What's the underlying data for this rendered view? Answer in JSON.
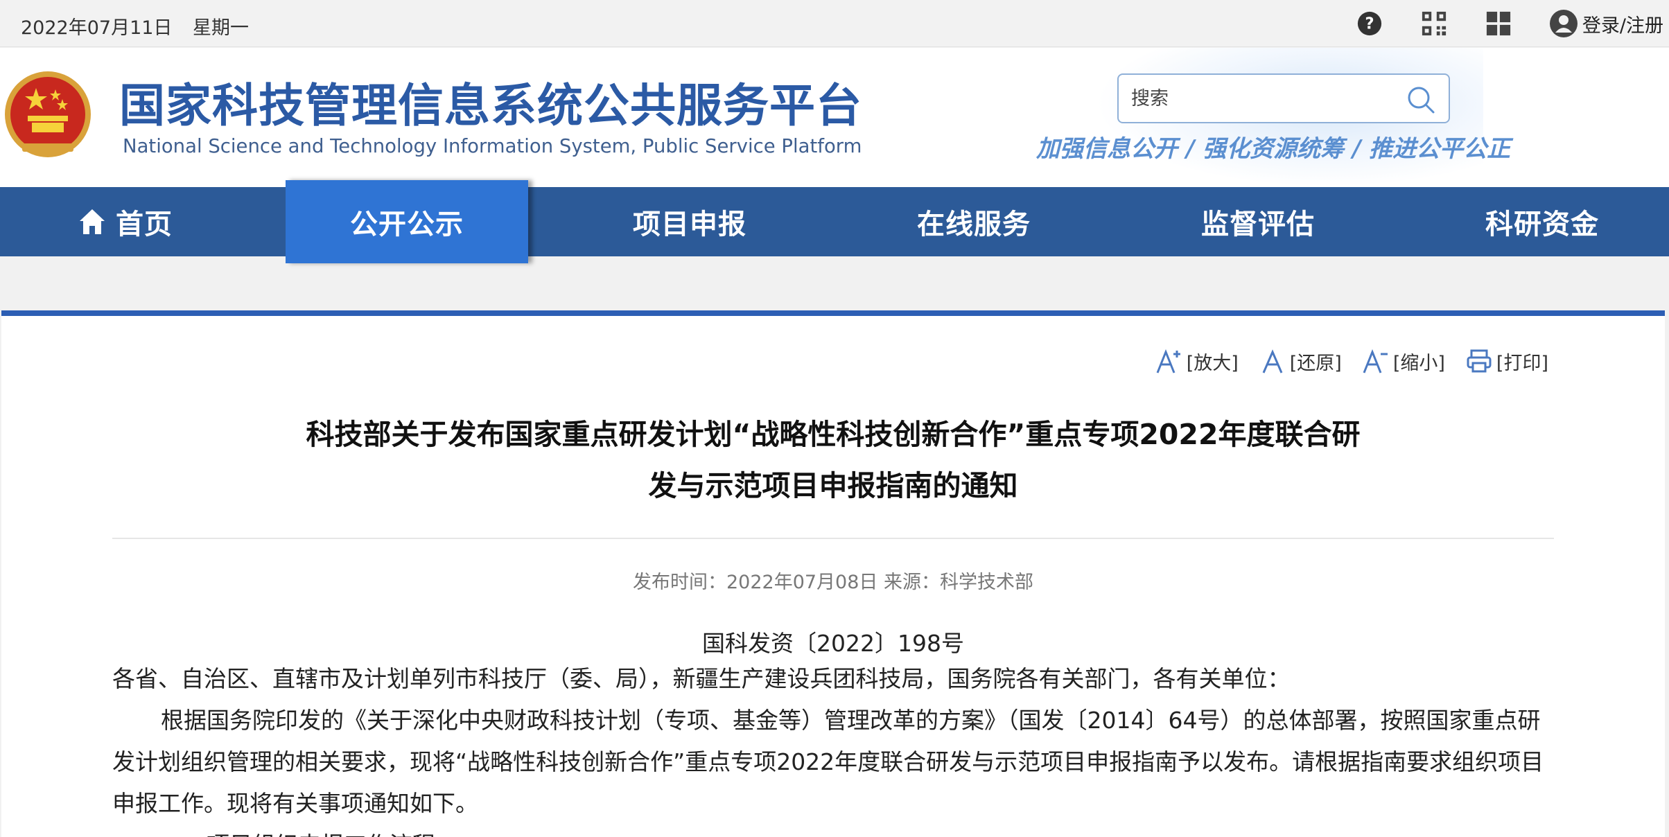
{
  "topbar": {
    "date": "2022年07月11日",
    "weekday": "星期一",
    "icons": [
      "help-icon",
      "qrcode-icon",
      "apps-grid-icon"
    ],
    "login_label": "登录/注册"
  },
  "header": {
    "title": "国家科技管理信息系统公共服务平台",
    "subtitle": "National Science and Technology Information System, Public Service Platform",
    "search": {
      "placeholder": "搜索"
    },
    "slogan": "加强信息公开 / 强化资源统筹 / 推进公平公正"
  },
  "nav": {
    "items": [
      {
        "label": "首页",
        "icon": "home-icon"
      },
      {
        "label": "公开公示",
        "active": true
      },
      {
        "label": "项目申报"
      },
      {
        "label": "在线服务"
      },
      {
        "label": "监督评估"
      },
      {
        "label": "科研资金"
      }
    ]
  },
  "article": {
    "font_tools": {
      "enlarge": "[放大]",
      "restore": "[还原]",
      "shrink": "[缩小]",
      "print": "[打印]"
    },
    "title_line1": "科技部关于发布国家重点研发计划“战略性科技创新合作”重点专项2022年度联合研",
    "title_line2": "发与示范项目申报指南的通知",
    "meta": "发布时间：2022年07月08日 来源：科学技术部",
    "doc_no": "国科发资〔2022〕198号",
    "addressee": "各省、自治区、直辖市及计划单列市科技厅（委、局），新疆生产建设兵团科技局，国务院各有关部门，各有关单位：",
    "paragraph1": "根据国务院印发的《关于深化中央财政科技计划（专项、基金等）管理改革的方案》（国发〔2014〕64号）的总体部署，按照国家重点研发计划组织管理的相关要求，现将“战略性科技创新合作”重点专项2022年度联合研发与示范项目申报指南予以发布。请根据指南要求组织项目申报工作。现将有关事项通知如下。",
    "section1": "一、项目组织申报工作流程"
  },
  "colors": {
    "nav_bg": "#2c5a98",
    "nav_active": "#2f74d4",
    "title_blue": "#2b5aa5",
    "panel_border": "#2c5eb4"
  }
}
